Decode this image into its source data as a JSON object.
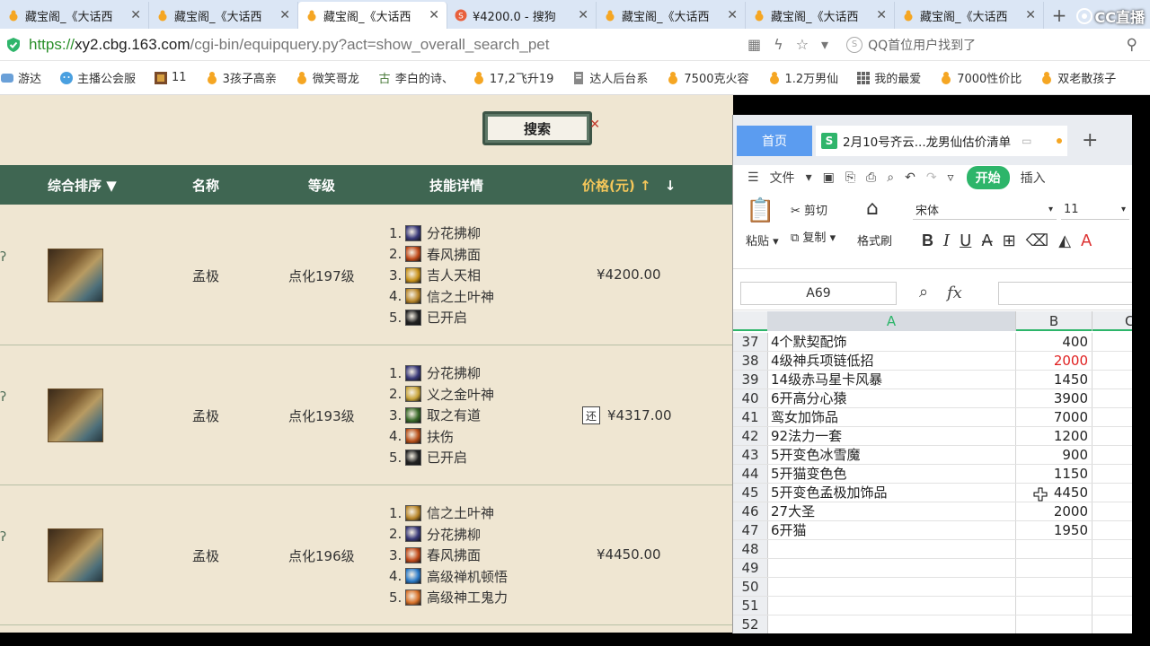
{
  "browser": {
    "tabs": [
      {
        "title": "藏宝阁_《大话西",
        "active": false
      },
      {
        "title": "藏宝阁_《大话西",
        "active": false
      },
      {
        "title": "藏宝阁_《大话西",
        "active": true
      },
      {
        "title": "¥4200.0 - 搜狗",
        "active": false
      },
      {
        "title": "藏宝阁_《大话西",
        "active": false
      },
      {
        "title": "藏宝阁_《大话西",
        "active": false
      },
      {
        "title": "藏宝阁_《大话西",
        "active": false
      }
    ],
    "close_glyph": "✕",
    "new_tab": "+",
    "brand_logo": "CC直播",
    "url_scheme": "https://",
    "url_host": "xy2.cbg.163.com",
    "url_path": "/cgi-bin/equipquery.py?act=show_overall_search_pet",
    "search_text": "QQ首位用户找到了",
    "bookmarks": [
      {
        "label": "游达",
        "icon": "game-icon"
      },
      {
        "label": "主播公会服",
        "icon": "face-icon"
      },
      {
        "label": "11",
        "icon": "pet-icon"
      },
      {
        "label": "3孩子高亲",
        "icon": "gourd-icon"
      },
      {
        "label": "微笑哥龙",
        "icon": "gourd-icon"
      },
      {
        "label": "李白的诗、",
        "icon": "poem-icon"
      },
      {
        "label": "17,2飞升19",
        "icon": "gourd-icon"
      },
      {
        "label": "达人后台系",
        "icon": "doc-icon"
      },
      {
        "label": "7500克火容",
        "icon": "gourd-icon"
      },
      {
        "label": "1.2万男仙",
        "icon": "gourd-icon"
      },
      {
        "label": "我的最爱",
        "icon": "grid-icon"
      },
      {
        "label": "7000性价比",
        "icon": "gourd-icon"
      },
      {
        "label": "双老散孩子",
        "icon": "gourd-icon"
      }
    ]
  },
  "page": {
    "search_button": "搜索",
    "headers": {
      "sort": "综合排序 ▼",
      "name": "名称",
      "level": "等级",
      "skills": "技能详情",
      "price": "价格(元)",
      "price_up": "↑",
      "price_down": "↓"
    },
    "rows": [
      {
        "name": "孟极",
        "level": "点化197级",
        "price": "¥4200.00",
        "haggle": "",
        "skills": [
          {
            "num": "1.",
            "name": "分花拂柳",
            "color": "#3a3a7a"
          },
          {
            "num": "2.",
            "name": "春风拂面",
            "color": "#c04a1a"
          },
          {
            "num": "3.",
            "name": "吉人天相",
            "color": "#c8921a"
          },
          {
            "num": "4.",
            "name": "信之土叶神",
            "color": "#b8862a"
          },
          {
            "num": "5.",
            "name": "已开启",
            "color": "#222222"
          }
        ]
      },
      {
        "name": "孟极",
        "level": "点化193级",
        "price": "¥4317.00",
        "haggle": "还",
        "skills": [
          {
            "num": "1.",
            "name": "分花拂柳",
            "color": "#3a3a7a"
          },
          {
            "num": "2.",
            "name": "义之金叶神",
            "color": "#c8a43a"
          },
          {
            "num": "3.",
            "name": "取之有道",
            "color": "#3a6a2a"
          },
          {
            "num": "4.",
            "name": "扶伤",
            "color": "#b8501a"
          },
          {
            "num": "5.",
            "name": "已开启",
            "color": "#222222"
          }
        ]
      },
      {
        "name": "孟极",
        "level": "点化196级",
        "price": "¥4450.00",
        "haggle": "",
        "skills": [
          {
            "num": "1.",
            "name": "信之土叶神",
            "color": "#b8862a"
          },
          {
            "num": "2.",
            "name": "分花拂柳",
            "color": "#3a3a7a"
          },
          {
            "num": "3.",
            "name": "春风拂面",
            "color": "#c04a1a"
          },
          {
            "num": "4.",
            "name": "高级禅机顿悟",
            "color": "#2a7ac8"
          },
          {
            "num": "5.",
            "name": "高级神工鬼力",
            "color": "#d8722a"
          }
        ]
      }
    ]
  },
  "wps": {
    "home_tab": "首页",
    "doc_logo": "S",
    "doc_title": "2月10号齐云...龙男仙估价清单",
    "new_tab": "+",
    "menu": {
      "file": "文件",
      "start": "开始",
      "insert": "插入"
    },
    "ribbon": {
      "paste": "粘贴",
      "cut": "剪切",
      "copy": "复制",
      "format_painter": "格式刷",
      "font": "宋体",
      "size": "11",
      "bold": "B",
      "italic": "I",
      "underline": "U"
    },
    "name_box": "A69",
    "fx": "fx",
    "columns": [
      "A",
      "B",
      "C"
    ],
    "rows": [
      {
        "n": "37",
        "a": "4个默契配饰",
        "b": "400",
        "red": false
      },
      {
        "n": "38",
        "a": "4级神兵项链低招",
        "b": "2000",
        "red": true
      },
      {
        "n": "39",
        "a": "14级赤马星卡风暴",
        "b": "1450",
        "red": false
      },
      {
        "n": "40",
        "a": "6开高分心猿",
        "b": "3900",
        "red": false
      },
      {
        "n": "41",
        "a": "鸾女加饰品",
        "b": "7000",
        "red": false
      },
      {
        "n": "42",
        "a": "92法力一套",
        "b": "1200",
        "red": false
      },
      {
        "n": "43",
        "a": "5开变色冰雪魔",
        "b": "900",
        "red": false
      },
      {
        "n": "44",
        "a": "5开猫变色色",
        "b": "1150",
        "red": false
      },
      {
        "n": "45",
        "a": "5开变色孟极加饰品",
        "b": "4450",
        "red": false
      },
      {
        "n": "46",
        "a": "27大圣",
        "b": "2000",
        "red": false
      },
      {
        "n": "47",
        "a": "6开猫",
        "b": "1950",
        "red": false
      },
      {
        "n": "48",
        "a": "",
        "b": "",
        "red": false
      },
      {
        "n": "49",
        "a": "",
        "b": "",
        "red": false
      },
      {
        "n": "50",
        "a": "",
        "b": "",
        "red": false
      },
      {
        "n": "51",
        "a": "",
        "b": "",
        "red": false
      },
      {
        "n": "52",
        "a": "",
        "b": "",
        "red": false
      }
    ]
  },
  "colors": {
    "accent_green": "#2db56a",
    "header_green": "#3f6652",
    "price_gold": "#f5c75a",
    "wps_blue": "#5b9cf0"
  }
}
